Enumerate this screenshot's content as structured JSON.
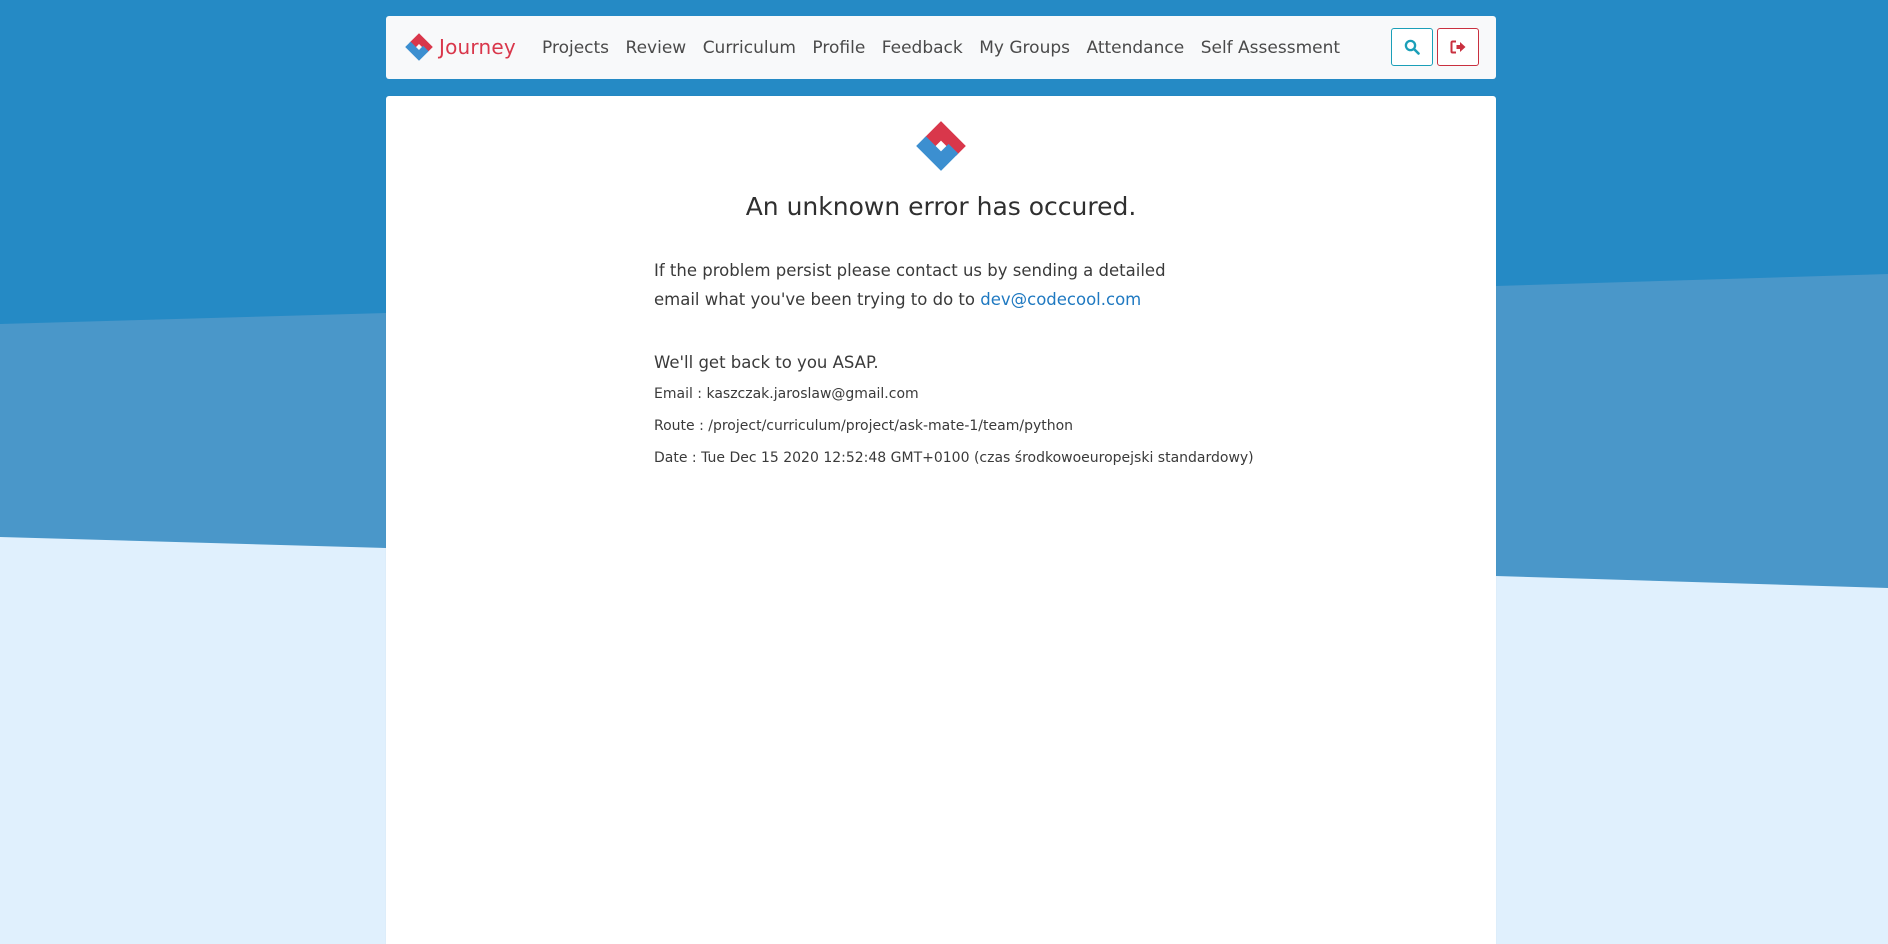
{
  "colors": {
    "top_background": "#258ac5",
    "band_background": "#4a97c9",
    "bottom_background": "#e0f0fd",
    "brand_red": "#d9374b",
    "brand_blue": "#3c8fd0",
    "link": "#1f79c1",
    "search_button": "#1b9fb8",
    "logout_button": "#c9303f"
  },
  "navbar": {
    "brand": "Journey",
    "links": [
      "Projects",
      "Review",
      "Curriculum",
      "Profile",
      "Feedback",
      "My Groups",
      "Attendance",
      "Self Assessment"
    ],
    "search_icon": "search-icon",
    "logout_icon": "sign-out-icon"
  },
  "error": {
    "title": "An unknown error has occured.",
    "message_prefix": "If the problem persist please contact us by sending a detailed email what you've been trying to do to ",
    "contact_email": "dev@codecool.com",
    "asap": "We'll get back to you ASAP.",
    "email_line": "Email : kaszczak.jaroslaw@gmail.com",
    "route_line": "Route : /project/curriculum/project/ask-mate-1/team/python",
    "date_line": "Date : Tue Dec 15 2020 12:52:48 GMT+0100 (czas środkowoeuropejski standardowy)"
  }
}
